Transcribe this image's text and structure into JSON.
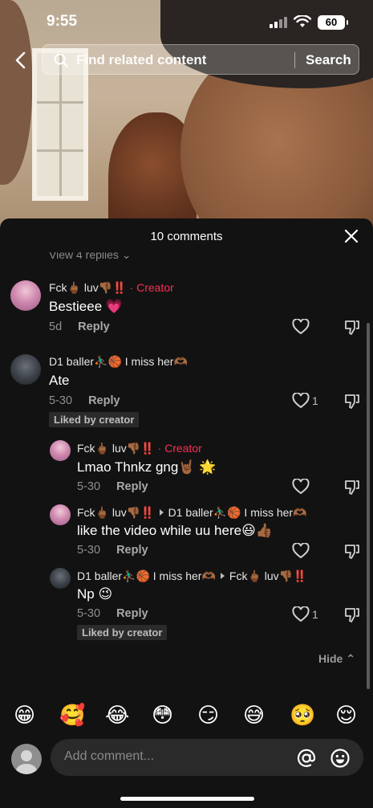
{
  "status": {
    "time": "9:55",
    "battery": "60"
  },
  "search": {
    "placeholder": "Find related content",
    "button": "Search"
  },
  "sheet": {
    "title": "10 comments",
    "view_replies": "View 4 replies"
  },
  "comments": [
    {
      "user": "Fck🖕🏾 luv👎🏾‼️",
      "tag": "· Creator",
      "text": "Bestieee 💗",
      "time": "5d",
      "reply": "Reply",
      "likes": "",
      "liked_by": ""
    },
    {
      "user": "D1 baller⛹🏾‍♂️🏀 I miss her🫶🏾",
      "tag": "",
      "text": "Ate",
      "time": "5-30",
      "reply": "Reply",
      "likes": "1",
      "liked_by": "Liked by creator"
    }
  ],
  "replies": [
    {
      "user": "Fck🖕🏾 luv👎🏾‼️",
      "tag": "· Creator",
      "to": "",
      "text": "Lmao Thnkz gng🤘🏾 🌟",
      "time": "5-30",
      "reply": "Reply",
      "likes": "",
      "liked_by": ""
    },
    {
      "user": "Fck🖕🏾 luv👎🏾‼️",
      "tag": "",
      "to": "D1 baller⛹🏾‍♂️🏀 I miss her🫶🏾",
      "text": "like the video while uu here😃👍🏾",
      "time": "5-30",
      "reply": "Reply",
      "likes": "",
      "liked_by": ""
    },
    {
      "user": "D1 baller⛹🏾‍♂️🏀 I miss her🫶🏾",
      "tag": "",
      "to": "Fck🖕🏾 luv👎🏾‼️",
      "text": "Np 😉",
      "time": "5-30",
      "reply": "Reply",
      "likes": "1",
      "liked_by": "Liked by creator"
    }
  ],
  "hide_label": "Hide",
  "emojis": [
    "😁",
    "🥰",
    "😂",
    "😳",
    "😏",
    "😅",
    "🥺",
    "😌"
  ],
  "input": {
    "placeholder": "Add comment..."
  },
  "colors": {
    "accent": "#fe2c55",
    "sheet_bg": "#121212",
    "input_bg": "#2a2a2a"
  }
}
